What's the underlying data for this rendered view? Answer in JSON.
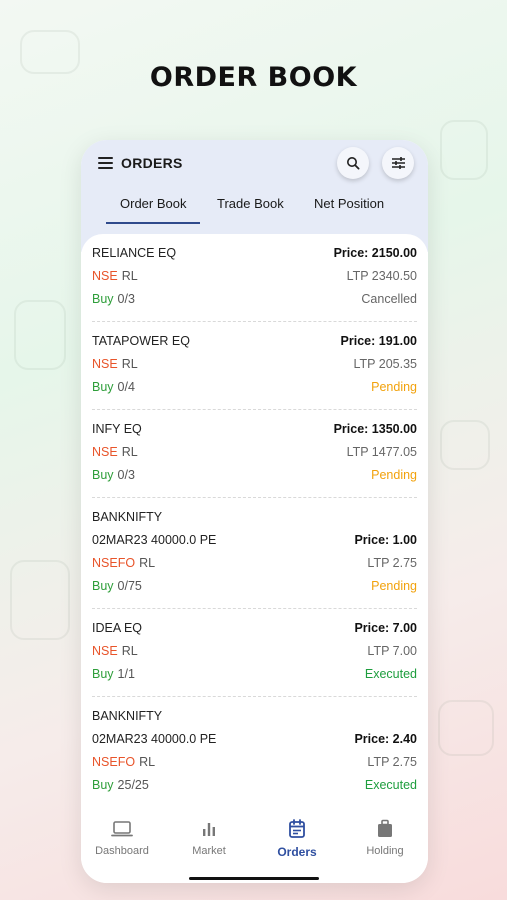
{
  "promo": {
    "title": "ORDER BOOK"
  },
  "header": {
    "title": "ORDERS"
  },
  "tabs": [
    {
      "label": "Order Book",
      "active": true
    },
    {
      "label": "Trade Book",
      "active": false
    },
    {
      "label": "Net Position",
      "active": false
    }
  ],
  "orders": [
    {
      "symbol": "RELIANCE EQ",
      "contract": "",
      "price": "Price: 2150.00",
      "exchange": "NSE",
      "product": "RL",
      "ltp": "LTP 2340.50",
      "side": "Buy",
      "qty": "0/3",
      "status": "Cancelled"
    },
    {
      "symbol": "TATAPOWER EQ",
      "contract": "",
      "price": "Price: 191.00",
      "exchange": "NSE",
      "product": "RL",
      "ltp": "LTP 205.35",
      "side": "Buy",
      "qty": "0/4",
      "status": "Pending"
    },
    {
      "symbol": "INFY EQ",
      "contract": "",
      "price": "Price: 1350.00",
      "exchange": "NSE",
      "product": "RL",
      "ltp": "LTP 1477.05",
      "side": "Buy",
      "qty": "0/3",
      "status": "Pending"
    },
    {
      "symbol": "BANKNIFTY",
      "contract": "02MAR23 40000.0 PE",
      "price": "Price: 1.00",
      "exchange": "NSEFO",
      "product": "RL",
      "ltp": "LTP 2.75",
      "side": "Buy",
      "qty": "0/75",
      "status": "Pending"
    },
    {
      "symbol": "IDEA EQ",
      "contract": "",
      "price": "Price: 7.00",
      "exchange": "NSE",
      "product": "RL",
      "ltp": "LTP 7.00",
      "side": "Buy",
      "qty": "1/1",
      "status": "Executed"
    },
    {
      "symbol": "BANKNIFTY",
      "contract": "02MAR23 40000.0 PE",
      "price": "Price: 2.40",
      "exchange": "NSEFO",
      "product": "RL",
      "ltp": "LTP 2.75",
      "side": "Buy",
      "qty": "25/25",
      "status": "Executed"
    }
  ],
  "bottom_nav": [
    {
      "label": "Dashboard",
      "icon": "laptop-icon",
      "active": false
    },
    {
      "label": "Market",
      "icon": "bar-chart-icon",
      "active": false
    },
    {
      "label": "Orders",
      "icon": "orders-icon",
      "active": true
    },
    {
      "label": "Holding",
      "icon": "briefcase-icon",
      "active": false
    }
  ],
  "colors": {
    "accent": "#2f4fa0",
    "exchange": "#e8542a",
    "buy": "#2e9e3a",
    "pending": "#f2a20c",
    "executed": "#1e9e3e",
    "cancelled": "#666666",
    "header_bg": "#e6ebf7"
  }
}
